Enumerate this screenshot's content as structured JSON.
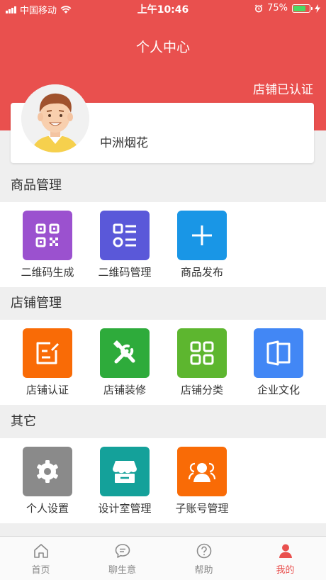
{
  "status_bar": {
    "carrier": "中国移动",
    "time": "上午10:46",
    "battery": "75%",
    "battery_level": 0.75,
    "battery_color": "#4cd964"
  },
  "header": {
    "title": "个人中心",
    "shop_status": "店铺已认证",
    "background_color": "#e9504e"
  },
  "profile": {
    "name": "中洲烟花"
  },
  "sections": [
    {
      "title": "商品管理",
      "items": [
        {
          "label": "二维码生成",
          "icon": "qr-code-icon",
          "color": "#9b51cf"
        },
        {
          "label": "二维码管理",
          "icon": "list-manage-icon",
          "color": "#5a58d9"
        },
        {
          "label": "商品发布",
          "icon": "plus-icon",
          "color": "#1996e6"
        }
      ]
    },
    {
      "title": "店铺管理",
      "items": [
        {
          "label": "店铺认证",
          "icon": "edit-document-icon",
          "color": "#f96b06"
        },
        {
          "label": "店铺装修",
          "icon": "tools-icon",
          "color": "#2eab3b"
        },
        {
          "label": "店铺分类",
          "icon": "grid-category-icon",
          "color": "#5db62f"
        },
        {
          "label": "企业文化",
          "icon": "book-icon",
          "color": "#4287f5"
        }
      ]
    },
    {
      "title": "其它",
      "items": [
        {
          "label": "个人设置",
          "icon": "gear-icon",
          "color": "#8a8a8a"
        },
        {
          "label": "设计室管理",
          "icon": "storefront-icon",
          "color": "#14a19a"
        },
        {
          "label": "子账号管理",
          "icon": "users-icon",
          "color": "#f96b06"
        }
      ]
    }
  ],
  "tabbar": {
    "items": [
      {
        "label": "首页",
        "icon": "home-icon"
      },
      {
        "label": "聊生意",
        "icon": "chat-icon"
      },
      {
        "label": "帮助",
        "icon": "help-icon"
      },
      {
        "label": "我的",
        "icon": "user-icon",
        "active": true
      }
    ],
    "active_color": "#e9504e"
  }
}
